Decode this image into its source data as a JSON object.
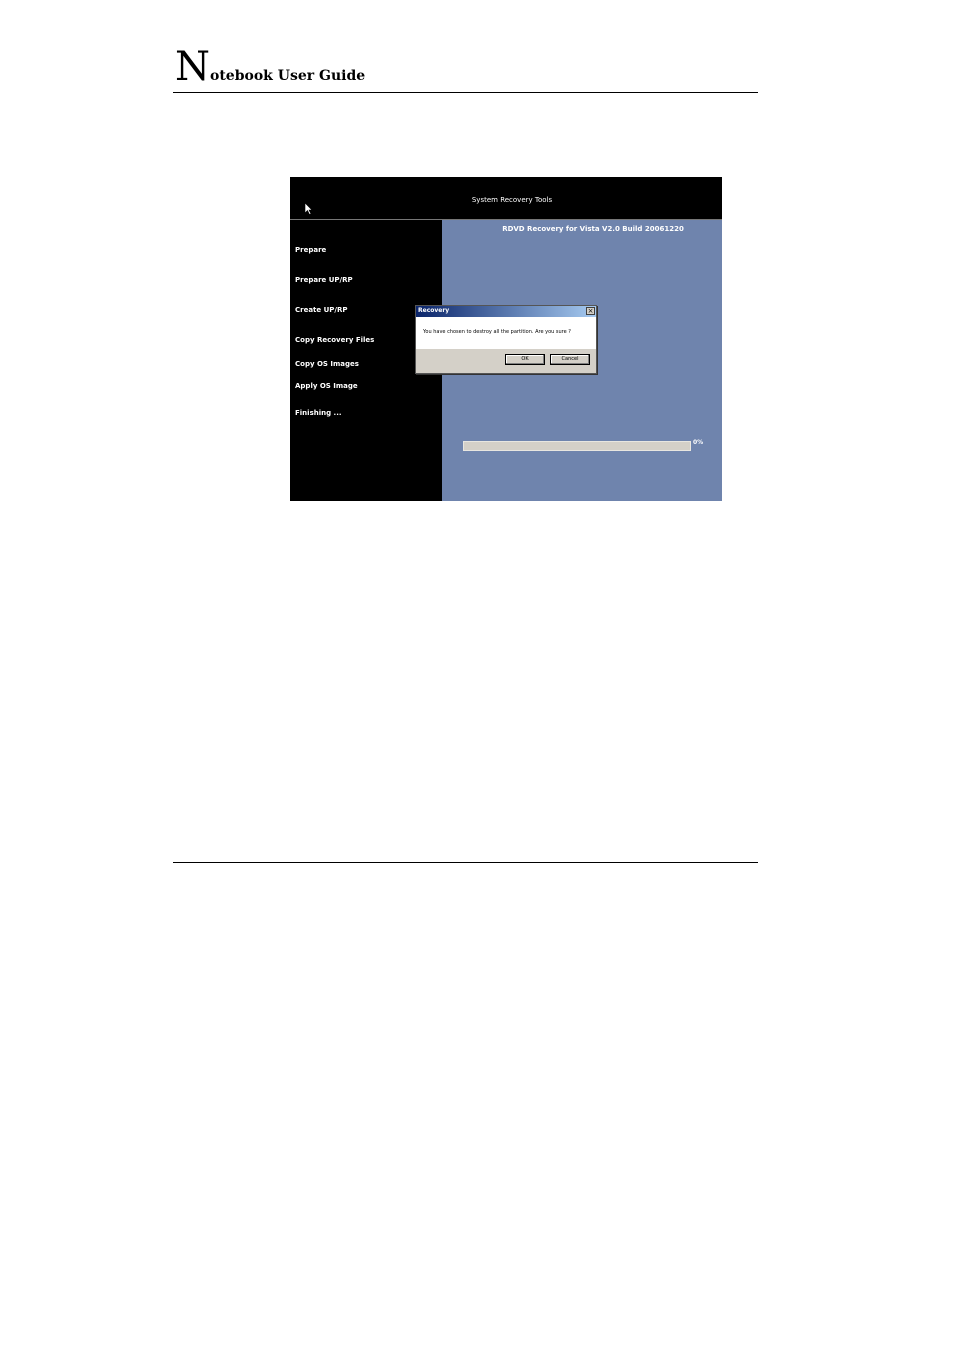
{
  "document": {
    "title_initial": "N",
    "title_rest": "otebook User Guide"
  },
  "app": {
    "title": "System Recovery Tools",
    "build": "RDVD Recovery for Vista V2.0 Build 20061220"
  },
  "steps": [
    "Prepare",
    "Prepare UP/RP",
    "Create UP/RP",
    "Copy Recovery Files",
    "Copy OS Images",
    "Apply OS Image",
    "Finishing ..."
  ],
  "progress": {
    "value_percent": 0,
    "label": "0%"
  },
  "dialog": {
    "title": "Recovery",
    "close_glyph": "×",
    "message": "You have chosen to destroy all the partition.  Are you sure ?",
    "ok_label": "OK",
    "cancel_label": "Cancel"
  },
  "icons": {
    "cursor": "mouse-pointer-icon",
    "close": "close-icon"
  },
  "colors": {
    "panel_blue": "#6f84ad",
    "titlebar_start": "#0a246a",
    "titlebar_end": "#a6caf0"
  }
}
